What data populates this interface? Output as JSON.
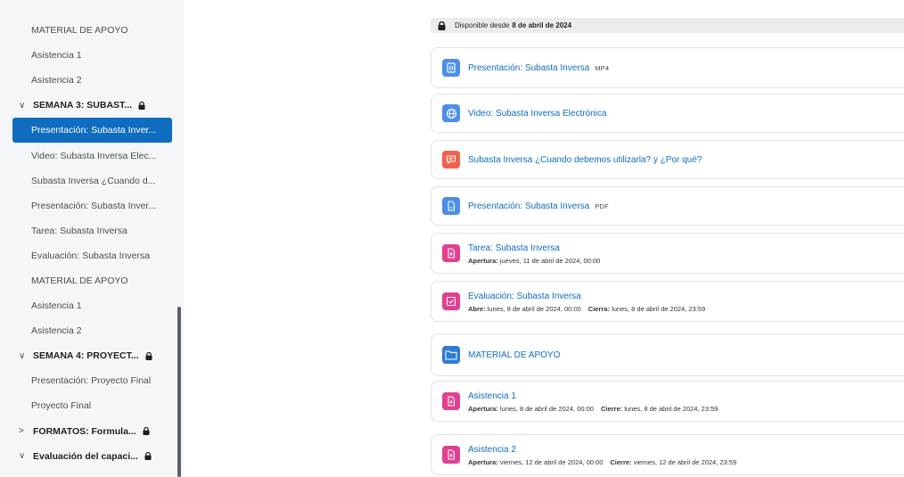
{
  "sidebar": {
    "items": [
      {
        "label": "MATERIAL DE APOYO",
        "type": "item"
      },
      {
        "label": "Asistencia 1",
        "type": "item"
      },
      {
        "label": "Asistencia 2",
        "type": "item"
      },
      {
        "label": "SEMANA 3: SUBAST...",
        "type": "section",
        "expanded": true,
        "locked": true
      },
      {
        "label": "Presentación: Subasta Inver...",
        "type": "item",
        "active": true
      },
      {
        "label": "Video: Subasta Inversa Elec...",
        "type": "item"
      },
      {
        "label": "Subasta Inversa ¿Cuando d...",
        "type": "item"
      },
      {
        "label": "Presentación: Subasta Inver...",
        "type": "item"
      },
      {
        "label": "Tarea: Subasta Inversa",
        "type": "item"
      },
      {
        "label": "Evaluación: Subasta Inversa",
        "type": "item"
      },
      {
        "label": "MATERIAL DE APOYO",
        "type": "item"
      },
      {
        "label": "Asistencia 1",
        "type": "item"
      },
      {
        "label": "Asistencia 2",
        "type": "item"
      },
      {
        "label": "SEMANA 4: PROYECT...",
        "type": "section",
        "expanded": true,
        "locked": true
      },
      {
        "label": "Presentación: Proyecto Final",
        "type": "item"
      },
      {
        "label": "Proyecto Final",
        "type": "item"
      },
      {
        "label": "FORMATOS: Formula...",
        "type": "section",
        "expanded": false,
        "locked": true
      },
      {
        "label": "Evaluación del capaci...",
        "type": "section",
        "expanded": true,
        "locked": true
      }
    ]
  },
  "availability": {
    "prefix": "Disponible desde",
    "date": "8 de abril de 2024"
  },
  "activities": [
    {
      "icon": "presentation-icon",
      "color": "blue",
      "title": "Presentación: Subasta Inversa",
      "badge": "MP4"
    },
    {
      "icon": "globe-icon",
      "color": "blue",
      "title": "Video: Subasta Inversa Electrónica"
    },
    {
      "icon": "forum-icon",
      "color": "orange",
      "title": "Subasta Inversa ¿Cuando debemos utilizarla? y ¿Por qué?"
    },
    {
      "icon": "file-icon",
      "color": "blue",
      "title": "Presentación: Subasta Inversa",
      "badge": "PDF"
    },
    {
      "icon": "assignment-icon",
      "color": "pink",
      "title": "Tarea: Subasta Inversa",
      "meta": [
        {
          "label": "Apertura:",
          "value": "jueves, 11 de abril de 2024, 00:00"
        }
      ]
    },
    {
      "icon": "quiz-icon",
      "color": "pink",
      "title": "Evaluación: Subasta Inversa",
      "meta": [
        {
          "label": "Abre:",
          "value": "lunes, 8 de abril de 2024, 00:00"
        },
        {
          "label": "Cierra:",
          "value": "lunes, 8 de abril de 2024, 23:59"
        }
      ]
    },
    {
      "icon": "folder-icon",
      "color": "folder",
      "title": "MATERIAL DE APOYO"
    },
    {
      "icon": "assignment-icon",
      "color": "pink",
      "title": "Asistencia 1",
      "meta": [
        {
          "label": "Apertura:",
          "value": "lunes, 8 de abril de 2024, 00:00"
        },
        {
          "label": "Cierre:",
          "value": "lunes, 8 de abril de 2024, 23:59"
        }
      ]
    },
    {
      "icon": "assignment-icon",
      "color": "pink",
      "title": "Asistencia 2",
      "meta": [
        {
          "label": "Apertura:",
          "value": "viernes, 12 de abril de 2024, 00:00"
        },
        {
          "label": "Cierre:",
          "value": "viernes, 12 de abril de 2024, 23:59"
        }
      ]
    }
  ],
  "colors": {
    "accent": "#0f6cbf",
    "icon_blue": "#4d8ee8",
    "icon_orange": "#f0624d",
    "icon_pink": "#e0408f",
    "sidebar_bg": "#f5f6f8"
  }
}
